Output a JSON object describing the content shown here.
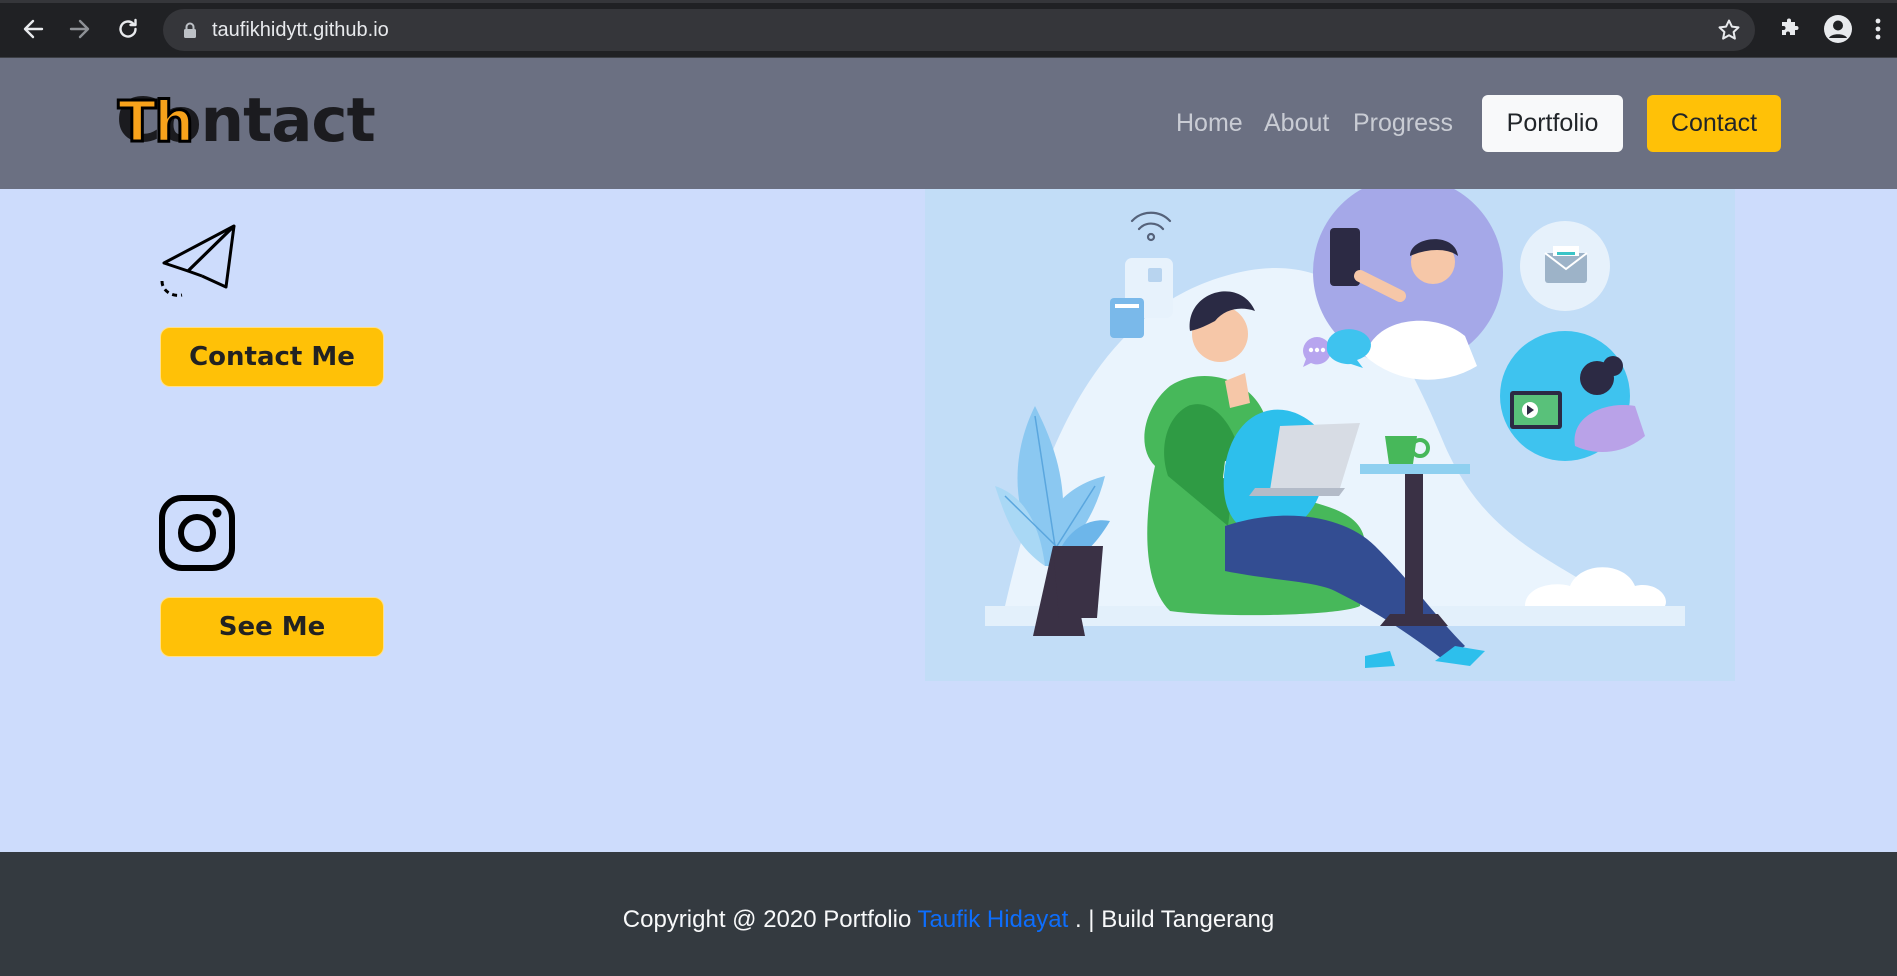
{
  "browser": {
    "url": "taufikhidytt.github.io"
  },
  "header": {
    "logo_base": "Contact",
    "logo_overlay": "Th",
    "nav": [
      "Home",
      "About",
      "Progress"
    ],
    "portfolio_button": "Portfolio",
    "contact_button": "Contact"
  },
  "main": {
    "email": {
      "icon": "paper-plane-icon",
      "button": "Contact Me"
    },
    "instagram": {
      "icon": "instagram-icon",
      "button": "See Me"
    },
    "illustration": "video-call-illustration"
  },
  "footer": {
    "prefix": "Copyright @ 2020 Portfolio ",
    "author": "Taufik Hidayat",
    "suffix": " . | Build Tangerang"
  },
  "colors": {
    "page_bg": "#cddcfc",
    "header_bg": "#6b7082",
    "accent": "#ffc107",
    "footer_bg": "#343a40",
    "link": "#0d6efd"
  }
}
